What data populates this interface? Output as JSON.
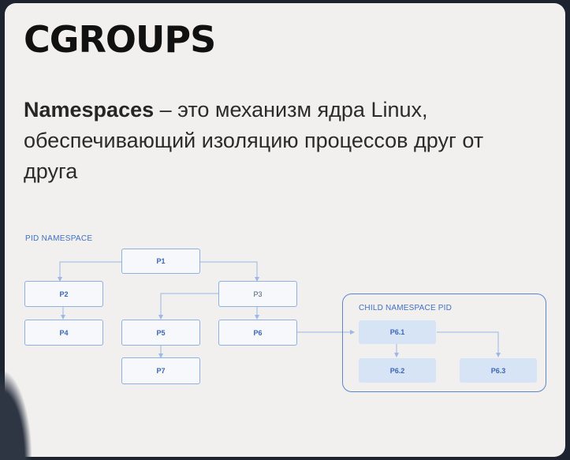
{
  "slide": {
    "title": "CGROUPS",
    "description_term": "Namespaces",
    "description_rest": " – это механизм ядра Linux, обеспечивающий изоляцию процессов друг от друга"
  },
  "diagram": {
    "pid_namespace_label": "PID NAMESPACE",
    "child_namespace_label": "CHILD NAMESPACE PID",
    "nodes": {
      "p1": "P1",
      "p2": "P2",
      "p3": "P3",
      "p4": "P4",
      "p5": "P5",
      "p6": "P6",
      "p7": "P7",
      "p6_1": "P6.1",
      "p6_2": "P6.2",
      "p6_3": "P6.3"
    },
    "colors": {
      "node_border": "#8fb0e3",
      "node_text": "#3a66b8",
      "child_node_fill": "#d6e4f6",
      "connector": "#9bb8e6",
      "frame": "#5b86cf"
    }
  }
}
